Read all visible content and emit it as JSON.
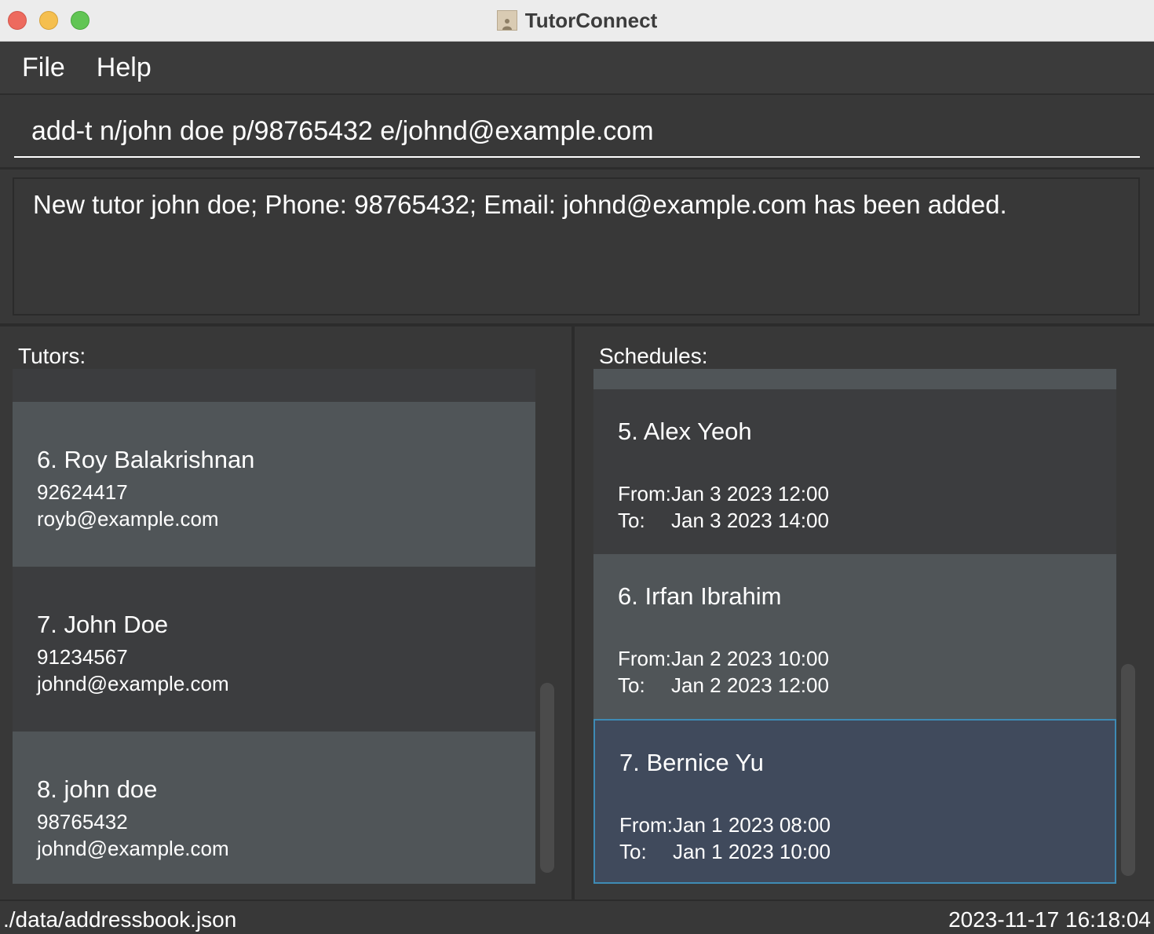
{
  "window": {
    "title": "TutorConnect"
  },
  "menu": {
    "items": [
      "File",
      "Help"
    ]
  },
  "command": {
    "value": "add-t n/john doe p/98765432 e/johnd@example.com"
  },
  "result": {
    "text": "New tutor john doe; Phone: 98765432; Email: johnd@example.com has been added."
  },
  "tutors": {
    "label": "Tutors:",
    "items": [
      {
        "name": "6.  Roy Balakrishnan",
        "phone": "92624417",
        "email": "royb@example.com"
      },
      {
        "name": "7.  John Doe",
        "phone": "91234567",
        "email": "johnd@example.com"
      },
      {
        "name": "8.  john doe",
        "phone": "98765432",
        "email": "johnd@example.com"
      }
    ]
  },
  "schedules": {
    "label": "Schedules:",
    "from_label": "From:",
    "to_label": "To:",
    "items": [
      {
        "name": "5.  Alex Yeoh",
        "from": "Jan 3 2023 12:00",
        "to": "Jan 3 2023 14:00"
      },
      {
        "name": "6.  Irfan Ibrahim",
        "from": "Jan 2 2023 10:00",
        "to": "Jan 2 2023 12:00"
      },
      {
        "name": "7.  Bernice Yu",
        "from": "Jan 1 2023 08:00",
        "to": "Jan 1 2023 10:00"
      }
    ]
  },
  "status": {
    "file_path": "./data/addressbook.json",
    "timestamp": "2023-11-17 16:18:04"
  },
  "colors": {
    "background": "#383838",
    "card_light": "#505558",
    "card_dark": "#3c3d3f",
    "selected": "#404a5c",
    "selected_border": "#3e8bb5"
  }
}
